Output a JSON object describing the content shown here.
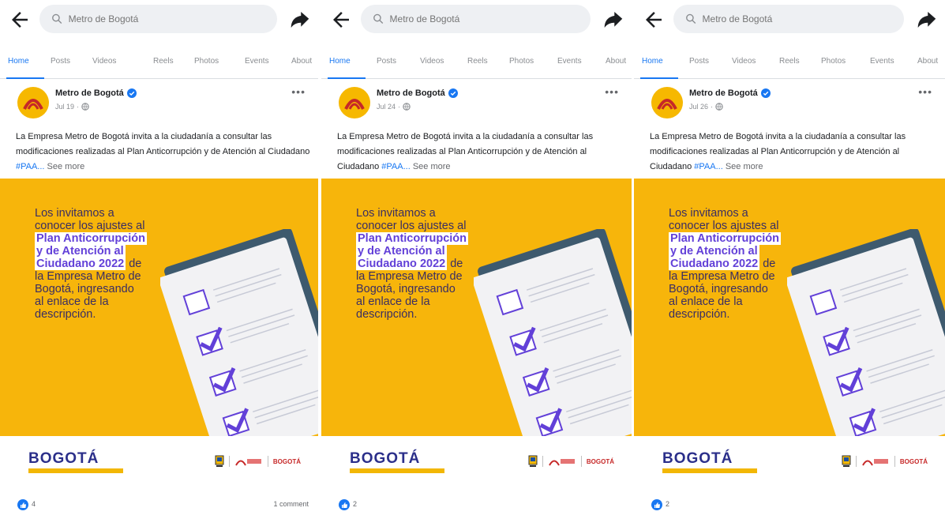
{
  "search": {
    "placeholder": "Metro de Bogotá"
  },
  "tabs": [
    "Home",
    "Posts",
    "Videos",
    "Reels",
    "Photos",
    "Events",
    "About"
  ],
  "post": {
    "page_name": "Metro de Bogotá",
    "text_intro": "La Empresa Metro de Bogotá invita a la ciudadanía a consultar las modificaciones realizadas al Plan Anticorrupción y de Atención al Ciudadano ",
    "hashtag": "#PAA...",
    "see_more": "See more",
    "image": {
      "line1": "Los invitamos a",
      "line2": "conocer los ajustes al",
      "highlight1": "Plan Anticorrupción",
      "highlight2": "y de Atención al",
      "highlight3": "Ciudadano 2022",
      "after_highlight": "de",
      "line6": "la Empresa Metro de",
      "line7": "Bogotá, ingresando",
      "line8": "al enlace de la",
      "line9": "descripción.",
      "logo_word": "BOGOTÁ",
      "partner_bogota": "BOGOTÁ"
    }
  },
  "panels": [
    {
      "date": "Jul 19",
      "likes": "4",
      "comments": "1 comment"
    },
    {
      "date": "Jul 24",
      "likes": "2",
      "comments": ""
    },
    {
      "date": "Jul 26",
      "likes": "2",
      "comments": ""
    }
  ],
  "colors": {
    "accent": "#1877f2",
    "image_bg": "#f7b50b",
    "highlight_text": "#6240d8",
    "document": "#f2f2f4",
    "document_border": "#3e5a6e"
  }
}
